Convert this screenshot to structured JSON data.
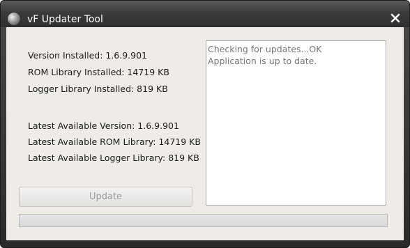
{
  "window": {
    "title": "vF Updater Tool",
    "icons": {
      "logo": "app-logo-icon",
      "close": "close-icon"
    }
  },
  "installed": {
    "version": "Version Installed: 1.6.9.901",
    "rom_library": "ROM Library Installed: 14719 KB",
    "logger_library": "Logger Library Installed: 819 KB"
  },
  "available": {
    "version": "Latest Available Version: 1.6.9.901",
    "rom_library": "Latest Available ROM Library: 14719 KB",
    "logger_library": "Latest Available Logger Library: 819 KB"
  },
  "log": {
    "lines": [
      "Checking for updates...OK",
      "Application is up to date."
    ]
  },
  "update_button": {
    "label": "Update",
    "enabled": false
  },
  "progress": {
    "value": 0
  }
}
